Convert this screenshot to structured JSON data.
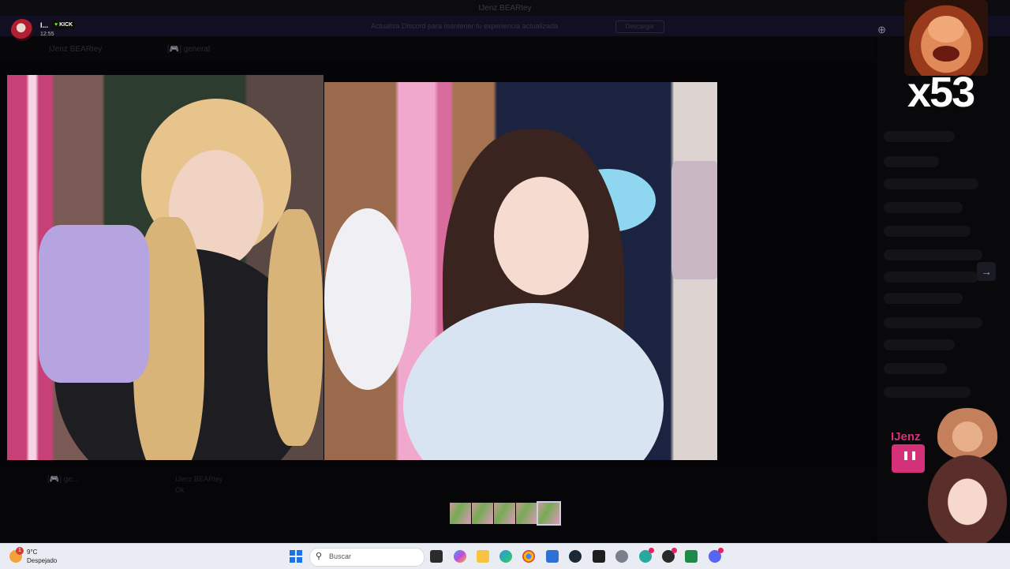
{
  "window": {
    "title": "IJenz BEARtey"
  },
  "banner": {
    "text": "Actualiza Discord para mantener tu experiencia actualizada",
    "button": "Descargar"
  },
  "channel_bar": {
    "server": "IJenz BEARtey",
    "channel": "[🎮] general"
  },
  "user": {
    "name": "I...",
    "badge": "KICK",
    "time": "12:55"
  },
  "viewer": {
    "counter": "x53",
    "next_arrow": "→"
  },
  "lower_chat": {
    "channel": "[🎮] ge...",
    "author": "IJenz BEARtey",
    "message": "Ok"
  },
  "streamer": {
    "name": "IJenz"
  },
  "thumbnails": {
    "count": 5,
    "active_index": 4
  },
  "taskbar": {
    "weather_temp": "9°C",
    "weather_condition": "Despejado",
    "weather_badge": "1",
    "search_placeholder": "Buscar",
    "apps": [
      "task-view-icon",
      "copilot-icon",
      "file-explorer-icon",
      "edge-icon",
      "chrome-icon",
      "store-icon",
      "steam-icon",
      "terminal-icon",
      "settings-icon",
      "app-icon",
      "obs-icon",
      "excel-icon",
      "discord-icon"
    ]
  },
  "colors": {
    "accent": "#d5307a",
    "kick_green": "#53fc18",
    "windows_blue": "#1a73e8"
  }
}
